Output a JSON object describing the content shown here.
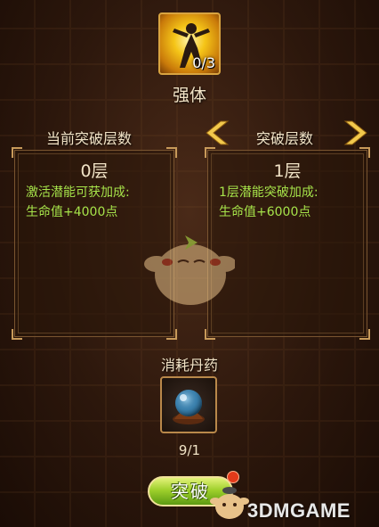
{
  "skill": {
    "level_count": "0/3",
    "name": "强体"
  },
  "labels": {
    "current_header": "当前突破层数",
    "next_header": "突破层数"
  },
  "current_panel": {
    "title": "0层",
    "line1": "激活潜能可获加成:",
    "line2": "生命值+4000点"
  },
  "next_panel": {
    "title": "1层",
    "line1": "1层潜能突破加成:",
    "line2": "生命值+6000点"
  },
  "consume": {
    "label": "消耗丹药",
    "count": "9/1"
  },
  "actions": {
    "break_label": "突破"
  },
  "watermark": {
    "text": "3DMGAME"
  },
  "colors": {
    "bonus_text": "#a6e34a",
    "label_text": "#f1e3c6",
    "accent_gold": "#d9a440",
    "button_green": "#9fd02c"
  }
}
